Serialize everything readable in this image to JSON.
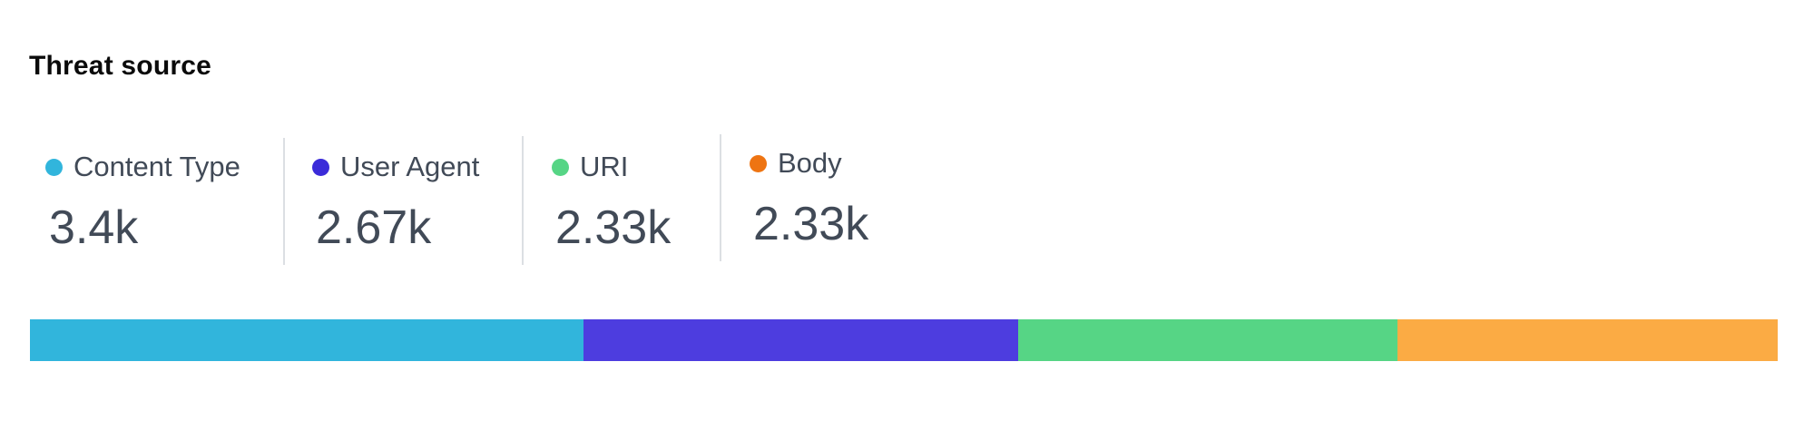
{
  "title": "Threat source",
  "chart_data": {
    "type": "bar",
    "orientation": "horizontal-stacked",
    "title": "Threat source",
    "categories": [
      "Content Type",
      "User Agent",
      "URI",
      "Body"
    ],
    "values": [
      3400,
      2670,
      2330,
      2330
    ],
    "labels": [
      "3.4k",
      "2.67k",
      "2.33k",
      "2.33k"
    ],
    "colors": [
      "#31b5dc",
      "#4d3ddf",
      "#56d585",
      "#fbab44"
    ],
    "dot_colors": [
      "#31b5dc",
      "#3b2bd9",
      "#56d585",
      "#ee7412"
    ],
    "legend": "top-left"
  }
}
